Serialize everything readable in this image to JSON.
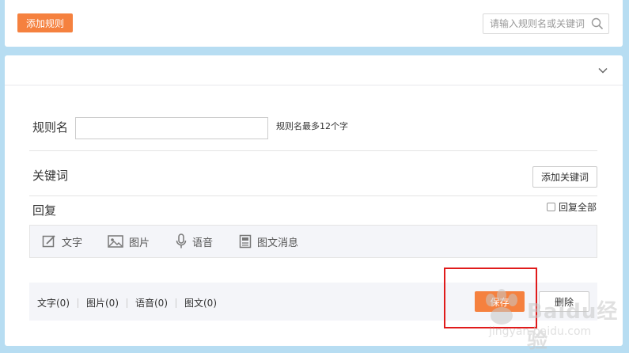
{
  "top": {
    "add_rule_label": "添加规则",
    "search_placeholder": "请输入规则名或关键词"
  },
  "form": {
    "rule_name_label": "规则名",
    "rule_name_value": "",
    "rule_name_hint": "规则名最多12个字",
    "keyword_label": "关键词",
    "add_keyword_label": "添加关键词",
    "reply_label": "回复",
    "reply_all_label": "回复全部",
    "reply_all_checked": false
  },
  "toolbar": {
    "items": [
      {
        "label": "文字",
        "icon": "edit-icon"
      },
      {
        "label": "图片",
        "icon": "image-icon"
      },
      {
        "label": "语音",
        "icon": "microphone-icon"
      },
      {
        "label": "图文消息",
        "icon": "news-icon"
      }
    ]
  },
  "footer": {
    "counts": [
      "文字(0)",
      "图片(0)",
      "语音(0)",
      "图文(0)"
    ],
    "save_label": "保存",
    "delete_label": "删除"
  },
  "watermark": {
    "text": "Baidu经验",
    "url": "jingyan.baidu.com"
  },
  "colors": {
    "accent": "#f5813f",
    "background": "#b7ddf2",
    "highlight": "#e01b1b"
  }
}
